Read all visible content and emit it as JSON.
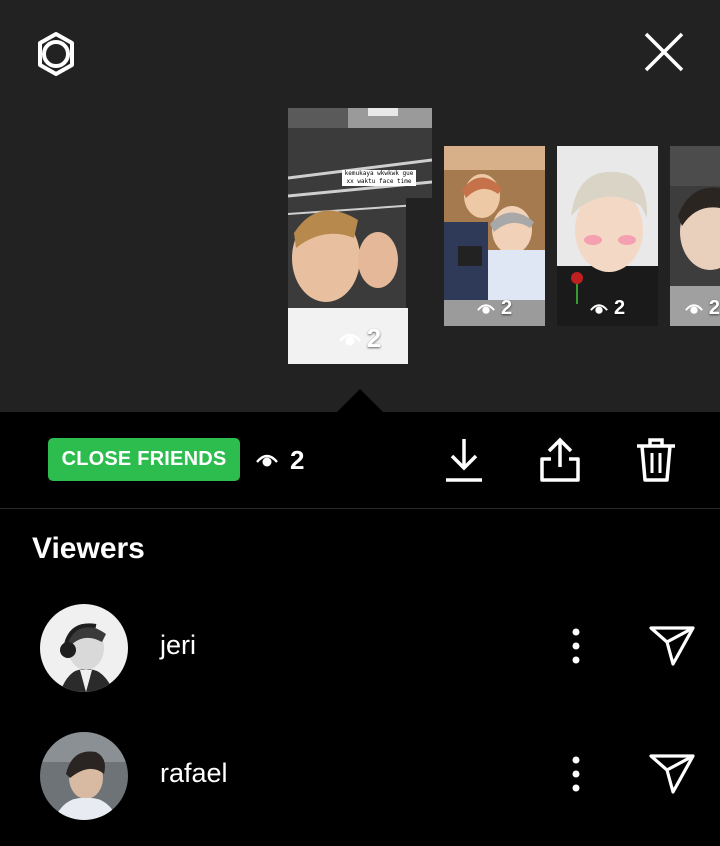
{
  "header": {
    "settings_icon": "gear-icon",
    "close_icon": "close-icon"
  },
  "stories": [
    {
      "caption": "kemukaya wkwkwk gue xx waktu face time",
      "views": "2",
      "selected": true
    },
    {
      "caption": "",
      "views": "2",
      "selected": false
    },
    {
      "caption": "",
      "views": "2",
      "selected": false
    },
    {
      "caption": "",
      "views": "2",
      "selected": false
    }
  ],
  "actions": {
    "badge_label": "CLOSE FRIENDS",
    "badge_color": "#2dbd4f",
    "view_count": "2",
    "download_icon": "download-icon",
    "share_icon": "share-icon",
    "delete_icon": "trash-icon"
  },
  "viewers": {
    "title": "Viewers",
    "items": [
      {
        "name": "jeri"
      },
      {
        "name": "rafael"
      }
    ]
  }
}
